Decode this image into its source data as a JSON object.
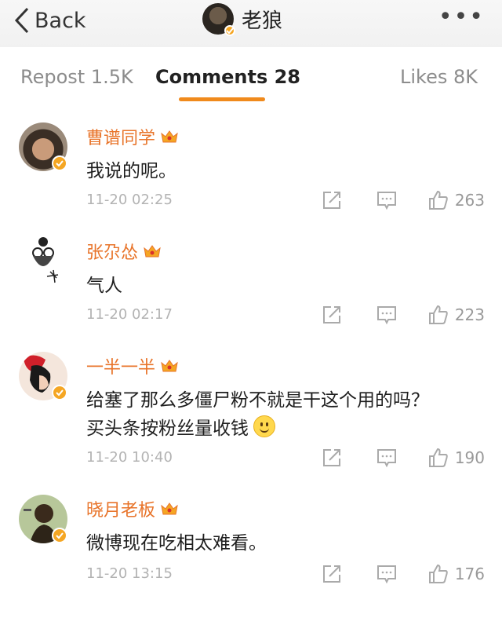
{
  "header": {
    "back_label": "Back",
    "title": "老狼",
    "more_label": "•••"
  },
  "tabs": [
    {
      "label": "Repost 1.5K"
    },
    {
      "label": "Comments 28"
    },
    {
      "label": "Likes 8K"
    }
  ],
  "colors": {
    "accent": "#f08a1c",
    "username": "#e8742a",
    "verified_badge": "#f5a623"
  },
  "icons": [
    "chevron-left-icon",
    "verified-icon",
    "crown-icon",
    "share-icon",
    "reply-icon",
    "thumbs-up-icon",
    "smile-emoji-icon"
  ],
  "comments": [
    {
      "name": "曹谱同学",
      "text": "我说的呢。",
      "time": "11-20 02:25",
      "likes": "263"
    },
    {
      "name": "张尕怂",
      "text": "气人",
      "time": "11-20 02:17",
      "likes": "223"
    },
    {
      "name": "一半一半",
      "text_line1": "给塞了那么多僵尸粉不就是干这个用的吗？",
      "text_line2": "买头条按粉丝量收钱",
      "time": "11-20 10:40",
      "likes": "190"
    },
    {
      "name": "晓月老板",
      "text": "微博现在吃相太难看。",
      "time": "11-20 13:15",
      "likes": "176"
    }
  ]
}
